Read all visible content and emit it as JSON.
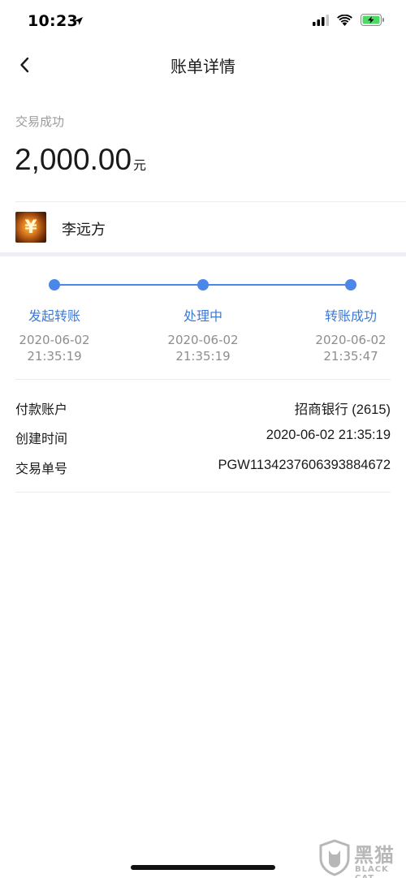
{
  "status_bar": {
    "time": "10:23",
    "icons": [
      "location-arrow-icon",
      "signal-icon",
      "wifi-icon",
      "battery-charging-icon"
    ]
  },
  "nav": {
    "title": "账单详情",
    "back_icon": "chevron-left-icon"
  },
  "transaction": {
    "status": "交易成功",
    "amount": "2,000.00",
    "currency_unit": "元"
  },
  "payee": {
    "name": "李远方",
    "avatar_glyph": "¥"
  },
  "progress": {
    "steps": [
      {
        "label": "发起转账",
        "date": "2020-06-02",
        "time": "21:35:19"
      },
      {
        "label": "处理中",
        "date": "2020-06-02",
        "time": "21:35:19"
      },
      {
        "label": "转账成功",
        "date": "2020-06-02",
        "time": "21:35:47"
      }
    ],
    "color": "#4b87e8"
  },
  "details": [
    {
      "label": "付款账户",
      "value": "招商银行 (2615)"
    },
    {
      "label": "创建时间",
      "value": "2020-06-02 21:35:19"
    },
    {
      "label": "交易单号",
      "value": "PGW1134237606393884672"
    }
  ],
  "watermark": {
    "text": "黑猫",
    "subtext": "BLACK CAT"
  }
}
